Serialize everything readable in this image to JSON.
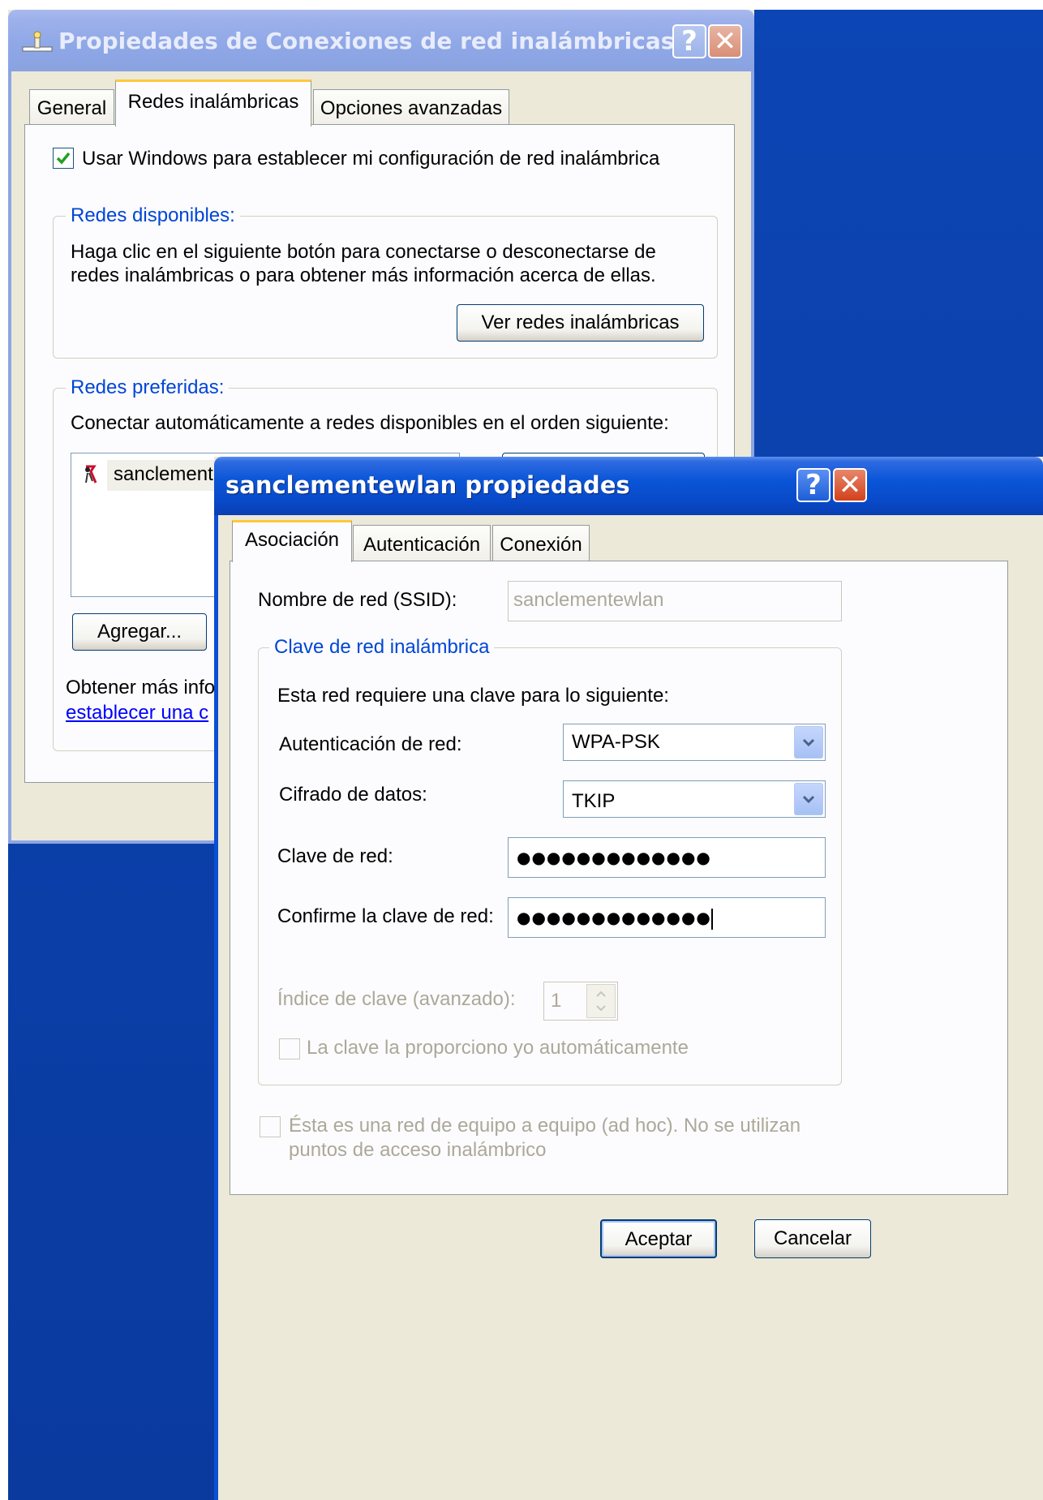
{
  "back_window": {
    "title": "Propiedades de Conexiones de red inalámbricas",
    "tabs": [
      "General",
      "Redes inalámbricas",
      "Opciones avanzadas"
    ],
    "use_windows_checkbox": "Usar Windows para establecer mi configuración de red inalámbrica",
    "available_networks": {
      "legend": "Redes disponibles:",
      "description_line1": "Haga clic en el siguiente botón para conectarse o desconectarse de",
      "description_line2": "redes inalámbricas o para obtener más información acerca de ellas.",
      "view_button": "Ver redes inalámbricas"
    },
    "preferred_networks": {
      "legend": "Redes preferidas:",
      "description": "Conectar automáticamente a redes disponibles en el orden siguiente:",
      "list_item": "sanclement",
      "add_button": "Agregar...",
      "info_text": "Obtener más info",
      "info_link": "establecer una c"
    }
  },
  "front_window": {
    "title": "sanclementewlan propiedades",
    "tabs": [
      "Asociación",
      "Autenticación",
      "Conexión"
    ],
    "ssid_label": "Nombre de red (SSID):",
    "ssid_value": "sanclementewlan",
    "key_group": {
      "legend": "Clave de red inalámbrica",
      "description": "Esta red requiere una clave para lo siguiente:",
      "auth_label": "Autenticación de red:",
      "auth_value": "WPA-PSK",
      "encryption_label": "Cifrado de datos:",
      "encryption_value": "TKIP",
      "key_label": "Clave de red:",
      "key_value": "●●●●●●●●●●●●●",
      "confirm_label": "Confirme la clave de red:",
      "confirm_value": "●●●●●●●●●●●●●",
      "index_label": "Índice de clave (avanzado):",
      "index_value": "1",
      "auto_key_label": "La clave la proporciono yo automáticamente"
    },
    "adhoc_line1": "Ésta es una red de equipo a equipo (ad hoc). No se utilizan",
    "adhoc_line2": "puntos de acceso inalámbrico",
    "ok_button": "Aceptar",
    "cancel_button": "Cancelar"
  },
  "colors": {
    "desktop": "#0a3a9e",
    "title_active": "#0a55d8",
    "title_inactive": "#8ea7e6",
    "window_face": "#ece9d8",
    "group_legend": "#0046d5"
  }
}
